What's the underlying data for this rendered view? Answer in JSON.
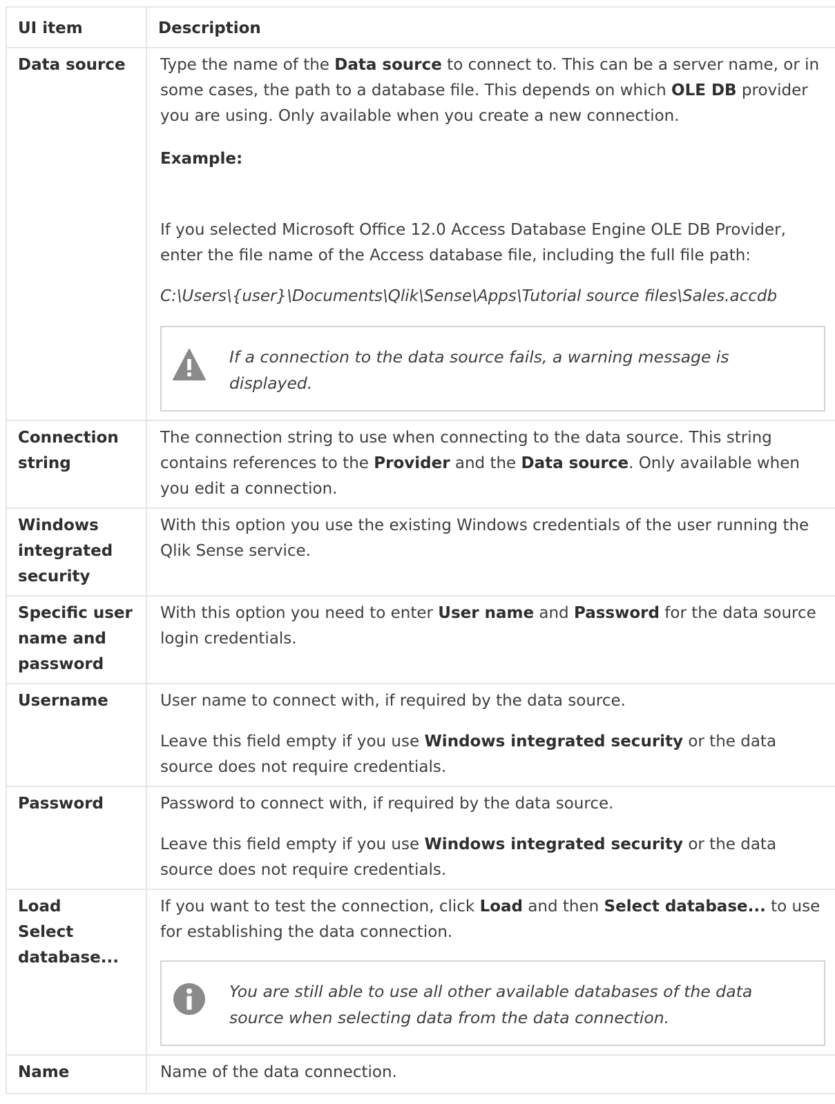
{
  "table": {
    "headers": [
      "UI item",
      "Description"
    ],
    "rows": {
      "data_source": {
        "item": "Data source",
        "p1_a": "Type the name of the ",
        "p1_b": "Data source",
        "p1_c": " to connect to. This can be a server name, or in some cases, the path to a database file. This depends on which ",
        "p1_d": "OLE DB",
        "p1_e": " provider you are using. Only available when you create a new connection.",
        "example_label": "Example:",
        "example_text": "If you selected Microsoft Office 12.0 Access Database Engine OLE DB Provider, enter the file name of the Access database file, including the full file path:",
        "example_path": "C:\\Users\\{user}\\Documents\\Qlik\\Sense\\Apps\\Tutorial source files\\Sales.accdb",
        "warning": "If a connection to the data source fails, a warning message is displayed."
      },
      "connection_string": {
        "item": "Connection string",
        "a": "The connection string to use when connecting to the data source. This string contains references to the ",
        "b": "Provider",
        "c": " and the ",
        "d": "Data source",
        "e": ". Only available when you edit a connection."
      },
      "windows_security": {
        "item": "Windows integrated security",
        "text": "With this option you use the existing Windows credentials of the user running the Qlik Sense service."
      },
      "specific_user": {
        "item": "Specific user name and password",
        "a": "With this option you need to enter ",
        "b": "User name",
        "c": " and ",
        "d": "Password",
        "e": " for the data source login credentials."
      },
      "username": {
        "item": "Username",
        "p1": "User name to connect with, if required by the data source.",
        "p2_a": "Leave this field empty if you use ",
        "p2_b": "Windows integrated security",
        "p2_c": " or the data source does not require credentials."
      },
      "password": {
        "item": "Password",
        "p1": "Password to connect with, if required by the data source.",
        "p2_a": "Leave this field empty if you use ",
        "p2_b": "Windows integrated security",
        "p2_c": " or the data source does not require credentials."
      },
      "load_select": {
        "item_line1": "Load",
        "item_line2": "Select database...",
        "a": "If you want to test the connection, click ",
        "b": "Load",
        "c": " and then ",
        "d": "Select database...",
        "e": " to use for establishing the data connection.",
        "info": "You are still able to use all other available databases of the data source when selecting data from the data connection."
      },
      "name": {
        "item": "Name",
        "text": "Name of the data connection."
      }
    }
  },
  "icons": {
    "warning": "warning-triangle-icon",
    "info": "info-circle-icon"
  },
  "colors": {
    "icon_gray": "#8a8a8a",
    "border": "#e6e6e6",
    "note_border": "#d3d3d3"
  }
}
